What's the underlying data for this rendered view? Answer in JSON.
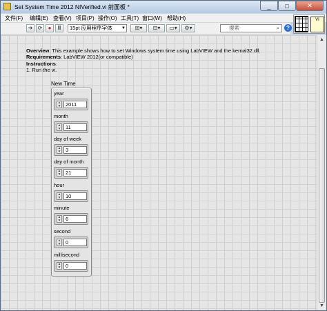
{
  "window": {
    "title": "Set System Time 2012 NIVerified.vi 前面板 *"
  },
  "menu": [
    "文件(F)",
    "编辑(E)",
    "查看(V)",
    "项目(P)",
    "操作(O)",
    "工具(T)",
    "窗口(W)",
    "帮助(H)"
  ],
  "toolbar": {
    "font": "15pt 应用程序字体",
    "search_placeholder": "搜索"
  },
  "doc": {
    "overview_label": "Overview",
    "overview_text": ":  This example shows how to set Windows system time using LabVIEW and the kernal32.dll.",
    "requirements_label": "Requirements",
    "requirements_text": ": LabVIEW 2012(or compatible)",
    "instructions_label": "Instructions",
    "instructions_text": ":",
    "step1": "1. Run the vi."
  },
  "cluster": {
    "label": "New Time",
    "fields": [
      {
        "label": "year",
        "value": "2011"
      },
      {
        "label": "month",
        "value": "11"
      },
      {
        "label": "day of week",
        "value": "3"
      },
      {
        "label": "day of month",
        "value": "21"
      },
      {
        "label": "hour",
        "value": "10"
      },
      {
        "label": "minute",
        "value": "6"
      },
      {
        "label": "second",
        "value": "0"
      },
      {
        "label": "millisecond",
        "value": "0"
      }
    ]
  }
}
